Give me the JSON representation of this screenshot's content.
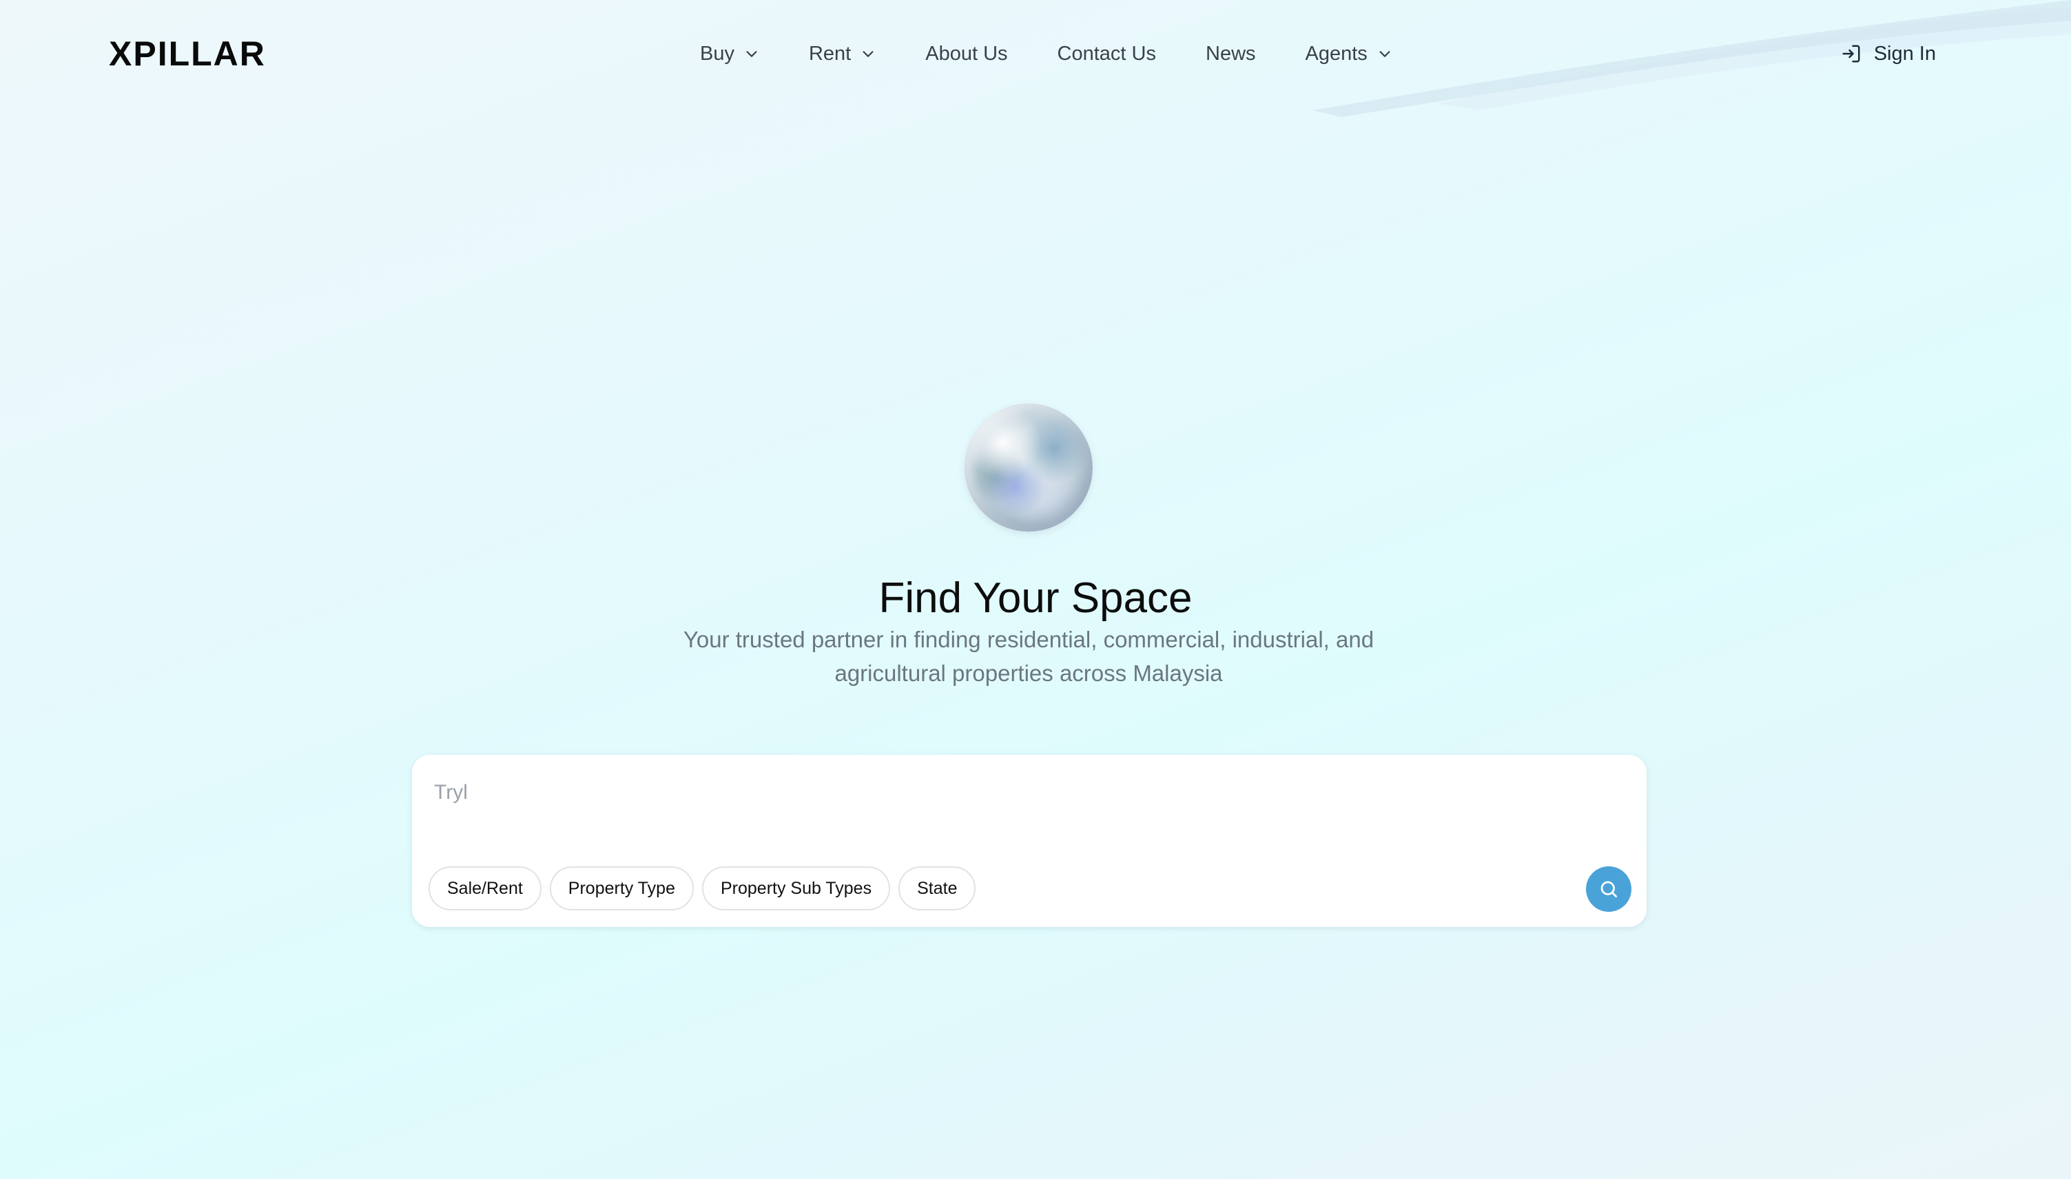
{
  "brand": {
    "logo_text": "XPILLAR"
  },
  "nav": {
    "items": [
      {
        "label": "Buy",
        "has_dropdown": true
      },
      {
        "label": "Rent",
        "has_dropdown": true
      },
      {
        "label": "About Us",
        "has_dropdown": false
      },
      {
        "label": "Contact Us",
        "has_dropdown": false
      },
      {
        "label": "News",
        "has_dropdown": false
      },
      {
        "label": "Agents",
        "has_dropdown": true
      }
    ],
    "signin_label": "Sign In",
    "signin_icon": "sign-in-icon"
  },
  "hero": {
    "title": "Find Your Space",
    "subtitle": "Your trusted partner in finding residential, commercial, industrial, and agricultural properties across Malaysia"
  },
  "search": {
    "placeholder": "Tryl",
    "filters": [
      {
        "label": "Sale/Rent"
      },
      {
        "label": "Property Type"
      },
      {
        "label": "Property Sub Types"
      },
      {
        "label": "State"
      }
    ],
    "button_icon": "search-icon"
  },
  "colors": {
    "accent": "#4aa3d8",
    "text_dark": "#0d0d0d",
    "text_muted": "#6b7680",
    "nav_text": "#3a4148"
  }
}
